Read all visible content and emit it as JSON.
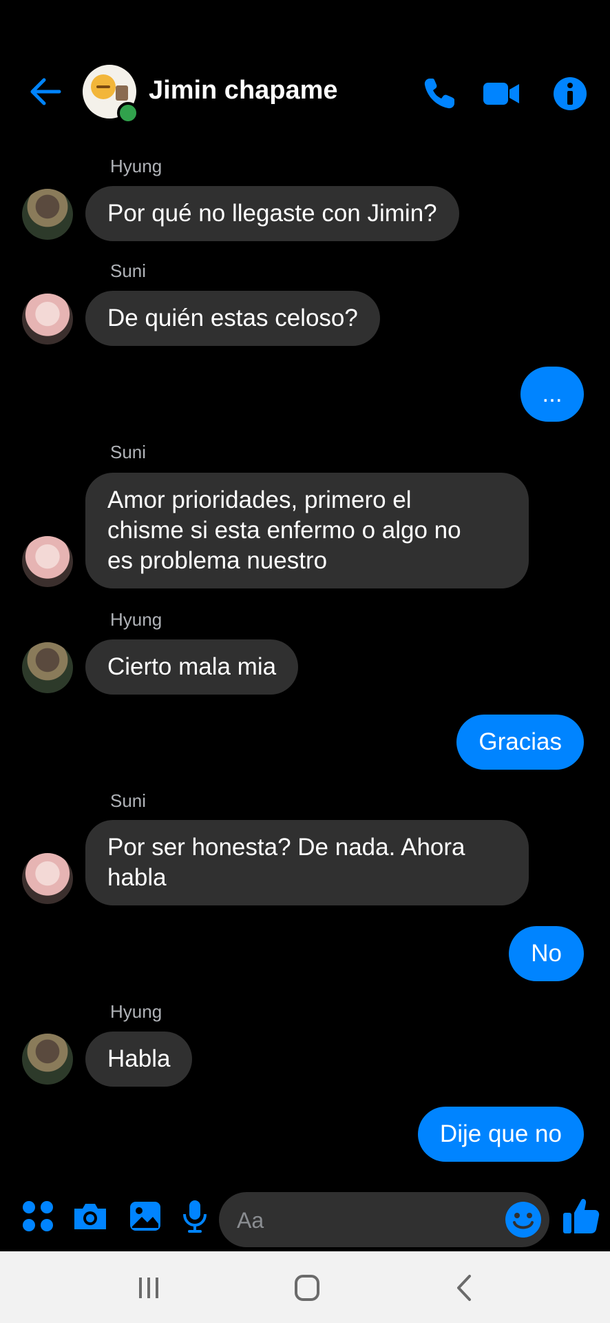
{
  "header": {
    "title": "Jimin chapame",
    "icons": [
      "back-arrow-icon",
      "phone-icon",
      "video-camera-icon",
      "info-icon"
    ]
  },
  "messages": [
    {
      "sender": "Hyung",
      "text": "Por qué no llegaste con Jimin?",
      "direction": "in"
    },
    {
      "sender": "Suni",
      "text": "De quién estas celoso?",
      "direction": "in"
    },
    {
      "text": "...",
      "direction": "out"
    },
    {
      "sender": "Suni",
      "text": "Amor prioridades, primero el\nchisme si esta enfermo o algo no\nes problema nuestro",
      "direction": "in"
    },
    {
      "sender": "Hyung",
      "text": "Cierto mala mia",
      "direction": "in"
    },
    {
      "text": "Gracias",
      "direction": "out"
    },
    {
      "sender": "Suni",
      "text": "Por ser honesta? De nada. Ahora\nhabla",
      "direction": "in"
    },
    {
      "text": "No",
      "direction": "out"
    },
    {
      "sender": "Hyung",
      "text": "Habla",
      "direction": "in"
    },
    {
      "text": "Dije que no",
      "direction": "out"
    }
  ],
  "composer": {
    "placeholder": "Aa",
    "icons": [
      "apps-grid-icon",
      "camera-icon",
      "gallery-icon",
      "microphone-icon",
      "emoji-icon",
      "thumbs-up-icon"
    ]
  },
  "navbar": {
    "icons": [
      "recent-apps-icon",
      "home-icon",
      "back-icon"
    ]
  },
  "colors": {
    "accent": "#0084ff",
    "background": "#000000",
    "incoming_bubble": "#303030",
    "sender_label": "#b0b3b8",
    "online": "#31a24c"
  }
}
